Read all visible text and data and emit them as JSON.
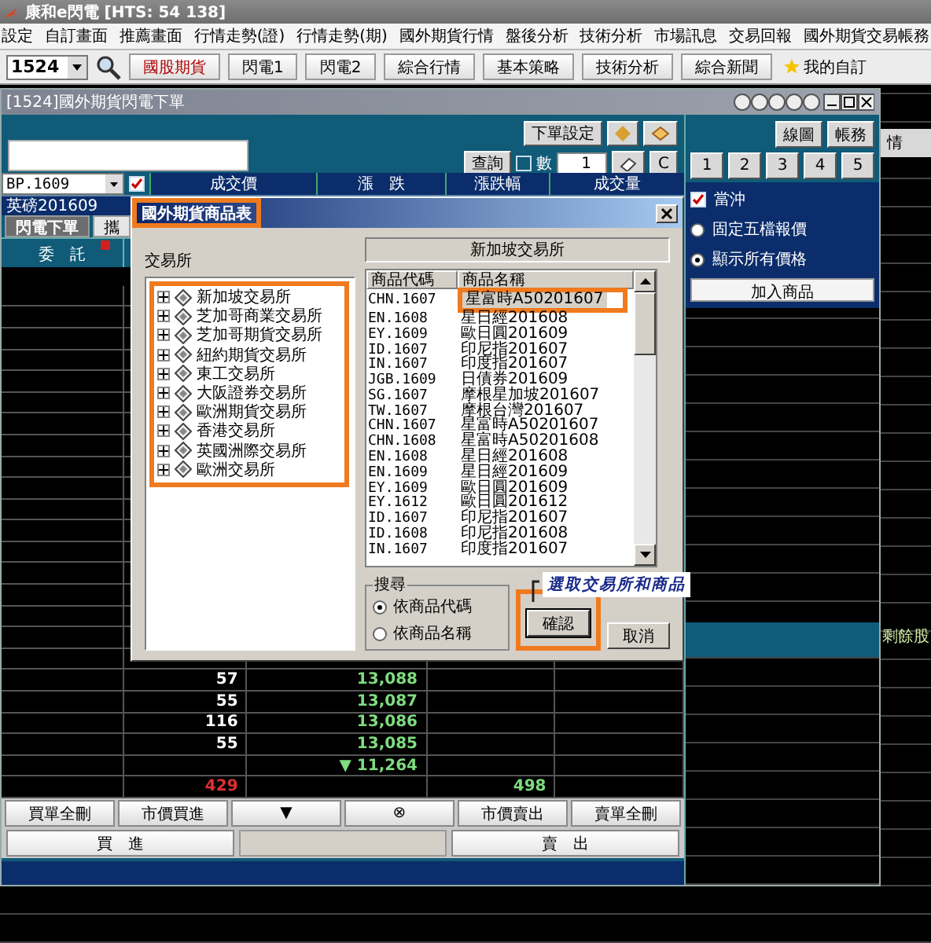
{
  "app_title": "康和e閃電 [HTS: 54 138]",
  "menu": [
    "設定",
    "自訂畫面",
    "推薦畫面",
    "行情走勢(證)",
    "行情走勢(期)",
    "國外期貨行情",
    "盤後分析",
    "技術分析",
    "市場訊息",
    "交易回報",
    "國外期貨交易帳務"
  ],
  "toolbar": {
    "symbol": "1524",
    "buttons": [
      {
        "label": "國股期貨",
        "selected": true
      },
      {
        "label": "閃電1",
        "selected": false
      },
      {
        "label": "閃電2",
        "selected": false
      },
      {
        "label": "綜合行情",
        "selected": false
      },
      {
        "label": "基本策略",
        "selected": false
      },
      {
        "label": "技術分析",
        "selected": false
      },
      {
        "label": "綜合新聞",
        "selected": false
      }
    ],
    "favorite": "我的自訂"
  },
  "window": {
    "title": "[1524]國外期貨閃電下單"
  },
  "order": {
    "setting_button": "下單設定",
    "query_button": "查詢",
    "qty_label": "數",
    "qty_checked": false,
    "qty": "1",
    "clear_button": "C",
    "symbol": "BP.1609",
    "symbol_checked": true,
    "product_name": "英磅201609",
    "columns": [
      "成交價",
      "漲　跌",
      "漲跌幅",
      "成交量"
    ],
    "tabs": [
      {
        "label": "閃電下單",
        "selected": true
      },
      {
        "label": "攜",
        "selected": false
      }
    ],
    "ladder_header": "委　託",
    "ladder_rows": [
      {
        "qty": "57",
        "price": "13,088"
      },
      {
        "qty": "55",
        "price": "13,087"
      },
      {
        "qty": "116",
        "price": "13,086"
      },
      {
        "qty": "55",
        "price": "13,085"
      },
      {
        "qty": "",
        "price": "▼ 11,264"
      }
    ],
    "totals": {
      "buy": "429",
      "sell": "498"
    },
    "actions": [
      "買單全刪",
      "市價買進",
      "▼",
      "⊗",
      "市價賣出",
      "賣單全刪"
    ],
    "buy_button": "買　進",
    "sell_button": "賣　出"
  },
  "side_panel": {
    "chart_button": "線圖",
    "account_button": "帳務",
    "presets": [
      "1",
      "2",
      "3",
      "4",
      "5"
    ],
    "options": [
      {
        "kind": "checkbox",
        "label": "當沖",
        "checked": true
      },
      {
        "kind": "radio",
        "label": "固定五檔報價",
        "selected": false
      },
      {
        "kind": "radio",
        "label": "顯示所有價格",
        "selected": true
      }
    ],
    "add_button": "加入商品"
  },
  "edge": {
    "tab": "情",
    "label": "剩餘股"
  },
  "dialog": {
    "title": "國外期貨商品表",
    "exchange_label": "交易所",
    "exchanges": [
      {
        "name": "新加坡交易所",
        "expanded": false
      },
      {
        "name": "芝加哥商業交易所",
        "expanded": false
      },
      {
        "name": "芝加哥期貨交易所",
        "expanded": false
      },
      {
        "name": "紐約期貨交易所",
        "expanded": false
      },
      {
        "name": "東工交易所",
        "expanded": false
      },
      {
        "name": "大阪證券交易所",
        "expanded": false
      },
      {
        "name": "歐洲期貨交易所",
        "expanded": false
      },
      {
        "name": "香港交易所",
        "expanded": false
      },
      {
        "name": "英國洲際交易所",
        "expanded": false
      },
      {
        "name": "歐洲交易所",
        "expanded": false
      }
    ],
    "current_exchange": "新加坡交易所",
    "list_columns": [
      "商品代碼",
      "商品名稱"
    ],
    "products": [
      {
        "code": "CHN.1607",
        "name": "星富時A50201607",
        "selected": true
      },
      {
        "code": "EN.1608",
        "name": "星日經201608",
        "selected": false
      },
      {
        "code": "EY.1609",
        "name": "歐日圓201609",
        "selected": false
      },
      {
        "code": "ID.1607",
        "name": "印尼指201607",
        "selected": false
      },
      {
        "code": "IN.1607",
        "name": "印度指201607",
        "selected": false
      },
      {
        "code": "JGB.1609",
        "name": "日債券201609",
        "selected": false
      },
      {
        "code": "SG.1607",
        "name": "摩根星加坡201607",
        "selected": false
      },
      {
        "code": "TW.1607",
        "name": "摩根台灣201607",
        "selected": false
      },
      {
        "code": "CHN.1607",
        "name": "星富時A50201607",
        "selected": false
      },
      {
        "code": "CHN.1608",
        "name": "星富時A50201608",
        "selected": false
      },
      {
        "code": "EN.1608",
        "name": "星日經201608",
        "selected": false
      },
      {
        "code": "EN.1609",
        "name": "星日經201609",
        "selected": false
      },
      {
        "code": "EY.1609",
        "name": "歐日圓201609",
        "selected": false
      },
      {
        "code": "EY.1612",
        "name": "歐日圓201612",
        "selected": false
      },
      {
        "code": "ID.1607",
        "name": "印尼指201607",
        "selected": false
      },
      {
        "code": "ID.1608",
        "name": "印尼指201608",
        "selected": false
      },
      {
        "code": "IN.1607",
        "name": "印度指201607",
        "selected": false
      }
    ],
    "search": {
      "label": "搜尋",
      "options": [
        {
          "label": "依商品代碼",
          "selected": true
        },
        {
          "label": "依商品名稱",
          "selected": false
        }
      ]
    },
    "ok_button": "確認",
    "cancel_button": "取消",
    "callout": "選取交易所和商品"
  }
}
